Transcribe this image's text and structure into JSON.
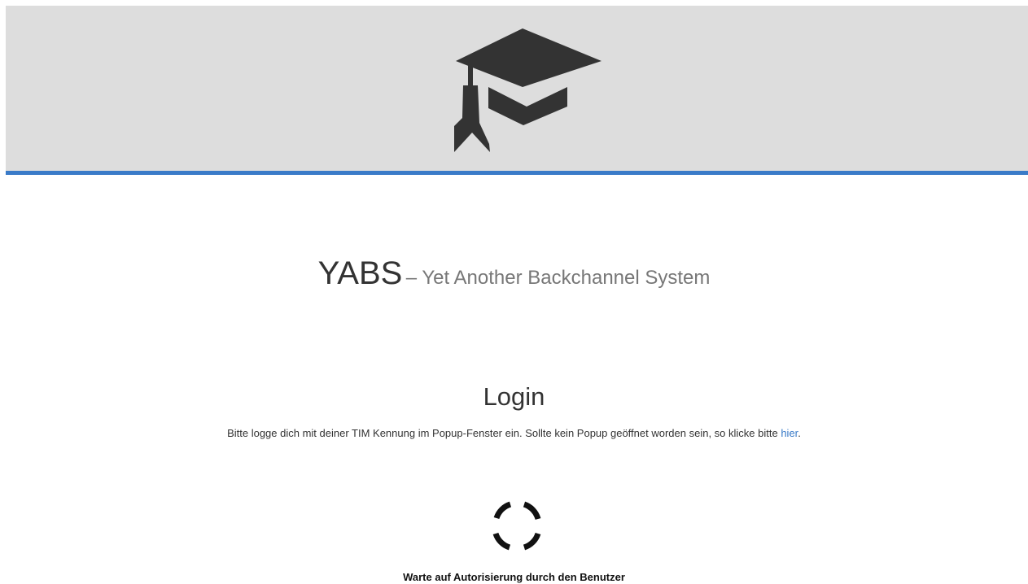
{
  "header": {
    "logo_icon": "graduation-cap-icon",
    "background_color": "#dddddd",
    "accent_color": "#3a7bc8",
    "icon_color": "#333333"
  },
  "title": {
    "app_name": "YABS",
    "subtitle": "– Yet Another Backchannel System"
  },
  "login": {
    "heading": "Login",
    "instruction": "Bitte logge dich mit deiner TIM Kennung im Popup-Fenster ein. Sollte kein Popup geöffnet worden sein, so klicke bitte ",
    "link_label": "hier",
    "instruction_end": "."
  },
  "status": {
    "spinner_icon": "loading-spinner-icon",
    "waiting_text": "Warte auf Autorisierung durch den Benutzer"
  }
}
